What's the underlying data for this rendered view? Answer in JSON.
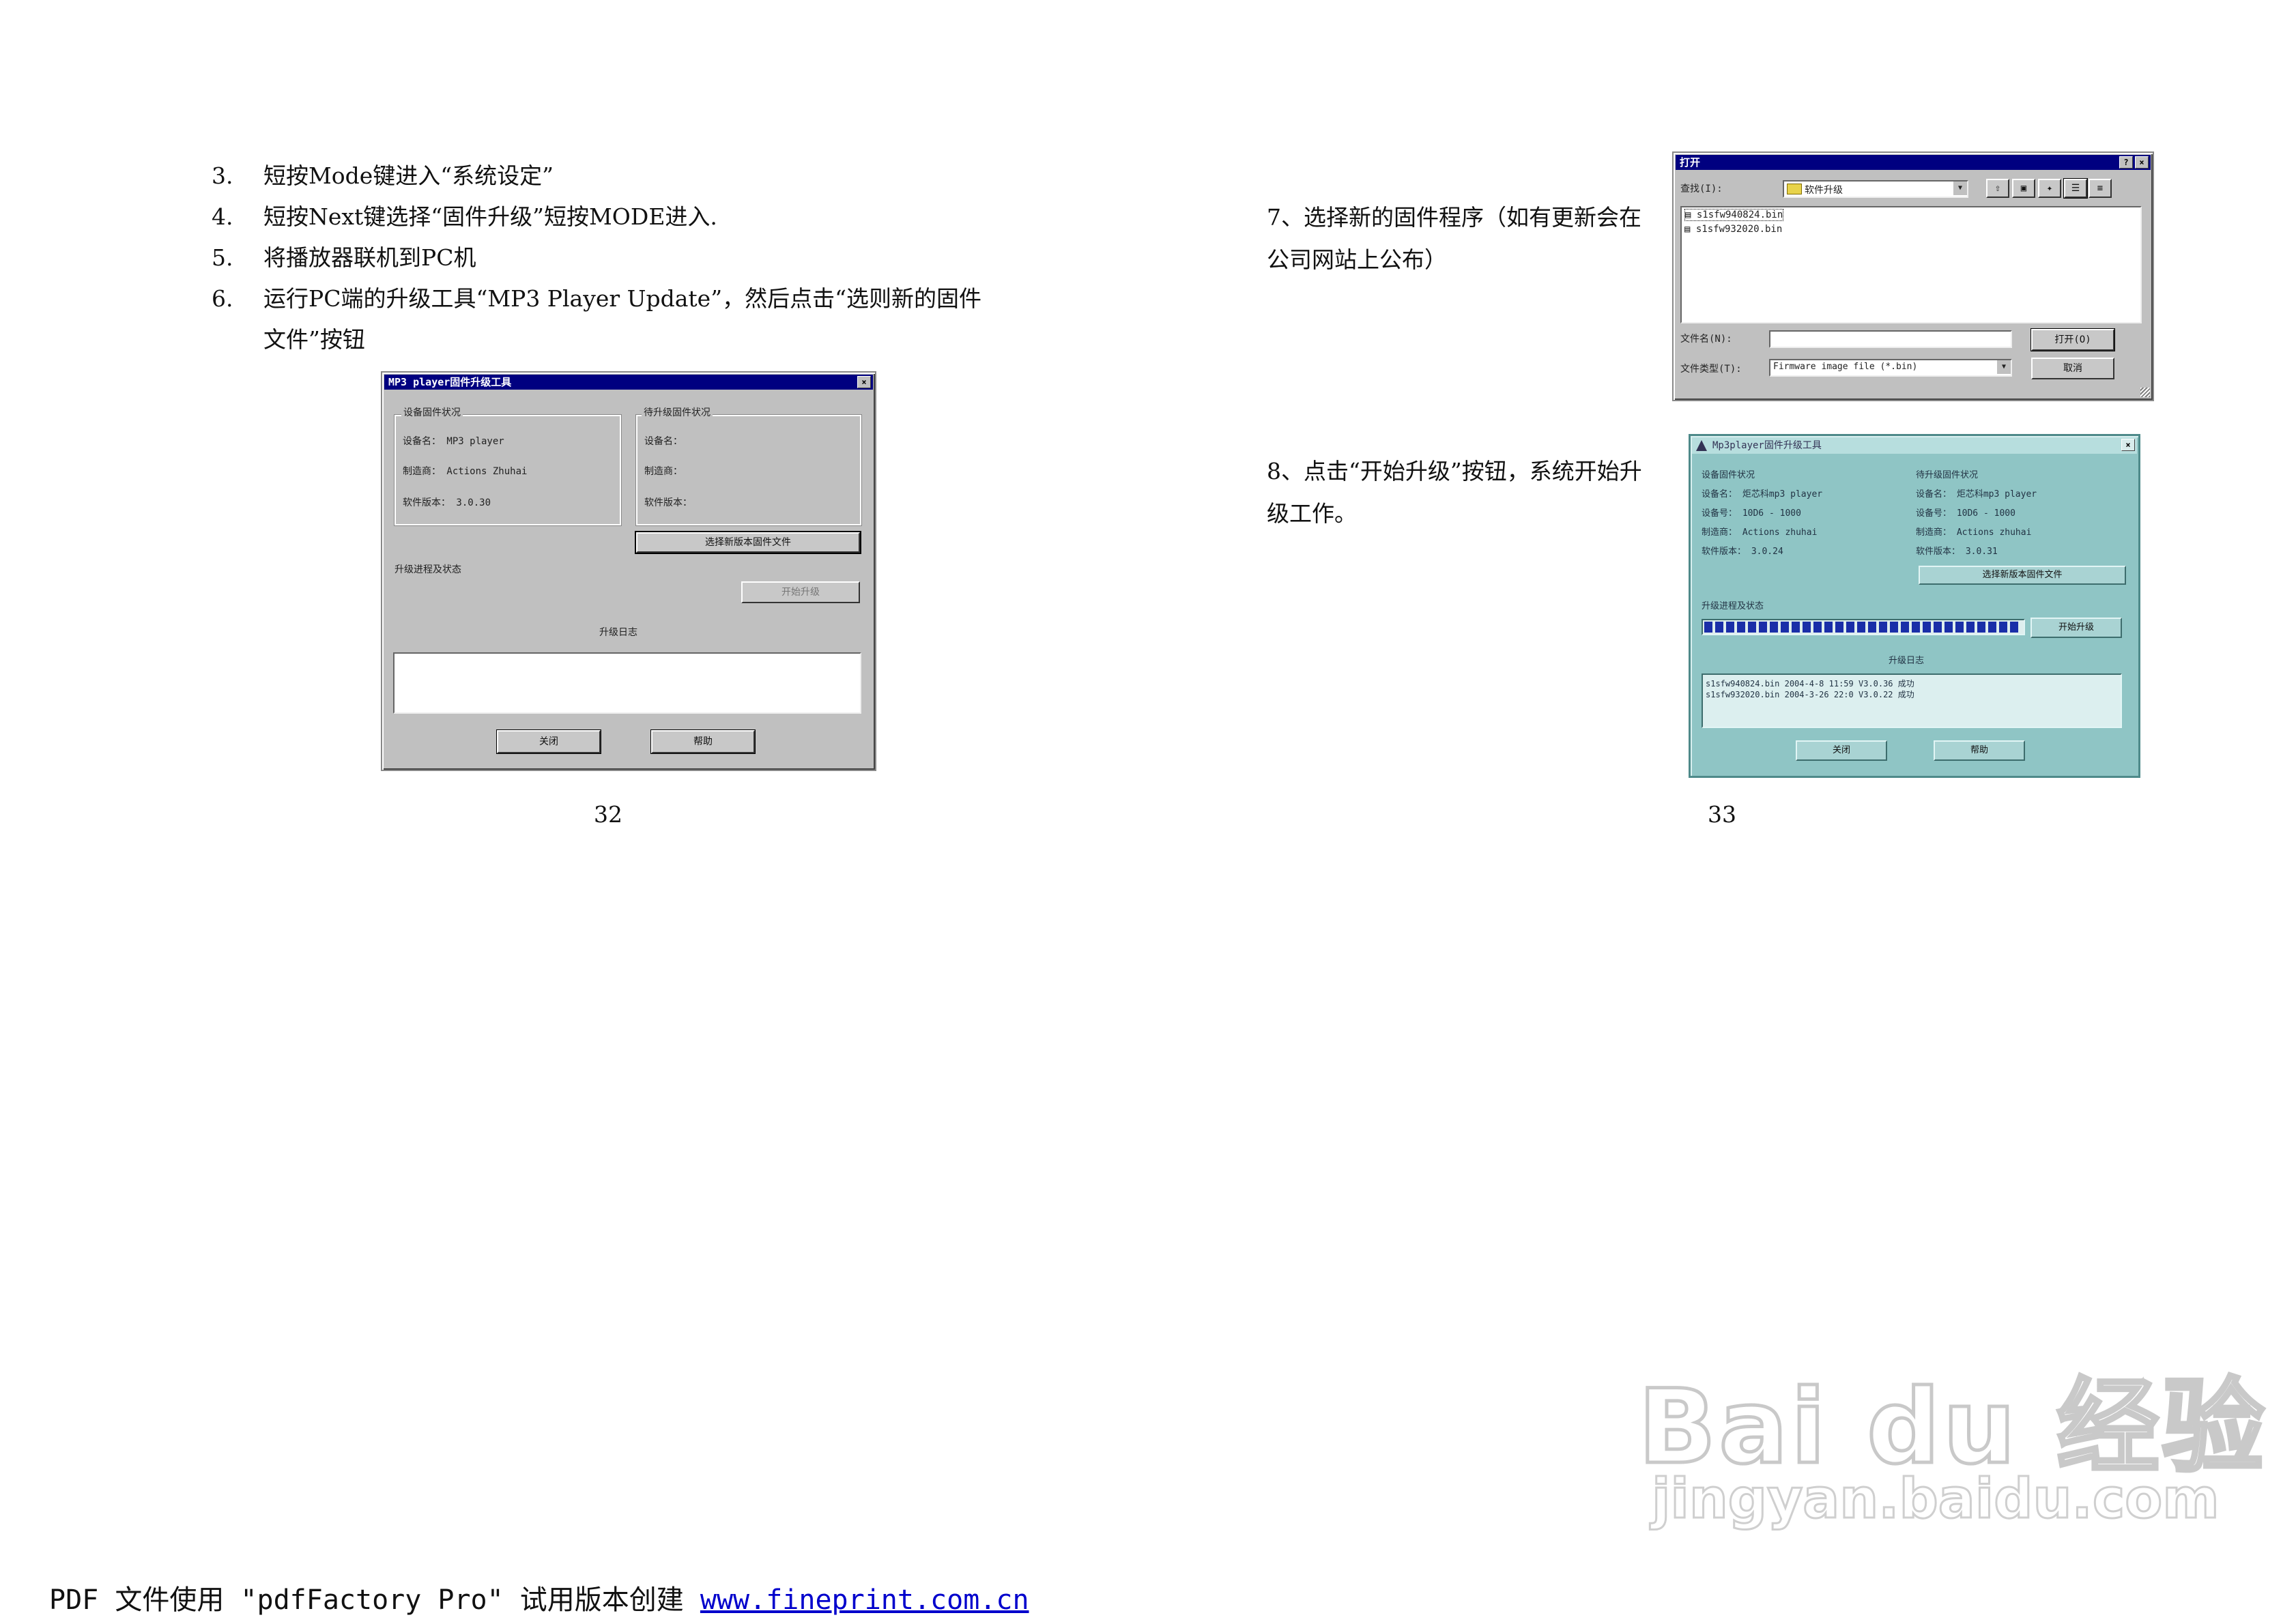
{
  "left_page": {
    "steps": [
      {
        "num": "3.",
        "text": "短按Mode键进入“系统设定”"
      },
      {
        "num": "4.",
        "text": "短按Next键选择“固件升级”短按MODE进入."
      },
      {
        "num": "5.",
        "text": "将播放器联机到PC机"
      },
      {
        "num": "6.",
        "text": "运行PC端的升级工具“MP3 Player Update”，然后点击“选则新的固件"
      }
    ],
    "step6_cont": "文件”按钮",
    "page_number": "32"
  },
  "dialog1": {
    "title": "MP3 player固件升级工具",
    "group_left_title": "设备固件状况",
    "group_right_title": "待升级固件状况",
    "left_labels": [
      "设备名：  MP3 player",
      "制造商：  Actions Zhuhai",
      "软件版本：  3.0.30"
    ],
    "right_labels": [
      "设备名：",
      "制造商：",
      "软件版本："
    ],
    "select_file_button": "选择新版本固件文件",
    "upgrade_label": "升级进程及状态",
    "start_button": "开始升级",
    "log_label": "升级日志",
    "close_button": "关闭",
    "help_button": "帮助"
  },
  "right_page": {
    "step7": "7、选择新的固件程序（如有更新会在公司网站上公布）",
    "step8": "8、点击“开始升级”按钮，系统开始升级工作。",
    "page_number": "33"
  },
  "dialog2": {
    "title": "打开",
    "lookin_label": "查找(I):",
    "lookin_value": "软件升级",
    "files": [
      "s1sfw940824.bin",
      "s1sfw932020.bin"
    ],
    "filename_label": "文件名(N):",
    "filetype_label": "文件类型(T):",
    "filetype_value": "Firmware image file (*.bin)",
    "open_button": "打开(O)",
    "cancel_button": "取消"
  },
  "dialog3": {
    "title": "Mp3player固件升级工具",
    "group_left_title": "设备固件状况",
    "left_labels": [
      "设备名：  炬芯科mp3 player",
      "设备号：  10D6 - 1000",
      "制造商：  Actions zhuhai",
      "软件版本：  3.0.24"
    ],
    "group_right_title": "待升级固件状况",
    "right_labels": [
      "设备名：  炬芯科mp3 player",
      "设备号：  10D6 - 1000",
      "制造商：  Actions zhuhai",
      "软件版本：  3.0.31"
    ],
    "select_file_button": "选择新版本固件文件",
    "progress_label": "升级进程及状态",
    "start_button": "开始升级",
    "log_label": "升级日志",
    "log_lines": [
      "s1sfw940824.bin  2004-4-8  11:59  V3.0.36  成功",
      "s1sfw932020.bin  2004-3-26  22:0  V3.0.22  成功"
    ],
    "close_button": "关闭",
    "help_button": "帮助",
    "progress": 1.0
  },
  "watermark": {
    "brand": "Bai du 经验",
    "url": "jingyan.baidu.com"
  },
  "footer": {
    "text": "PDF 文件使用 \"pdfFactory Pro\" 试用版本创建 ",
    "link": "www.fineprint.com.cn"
  }
}
